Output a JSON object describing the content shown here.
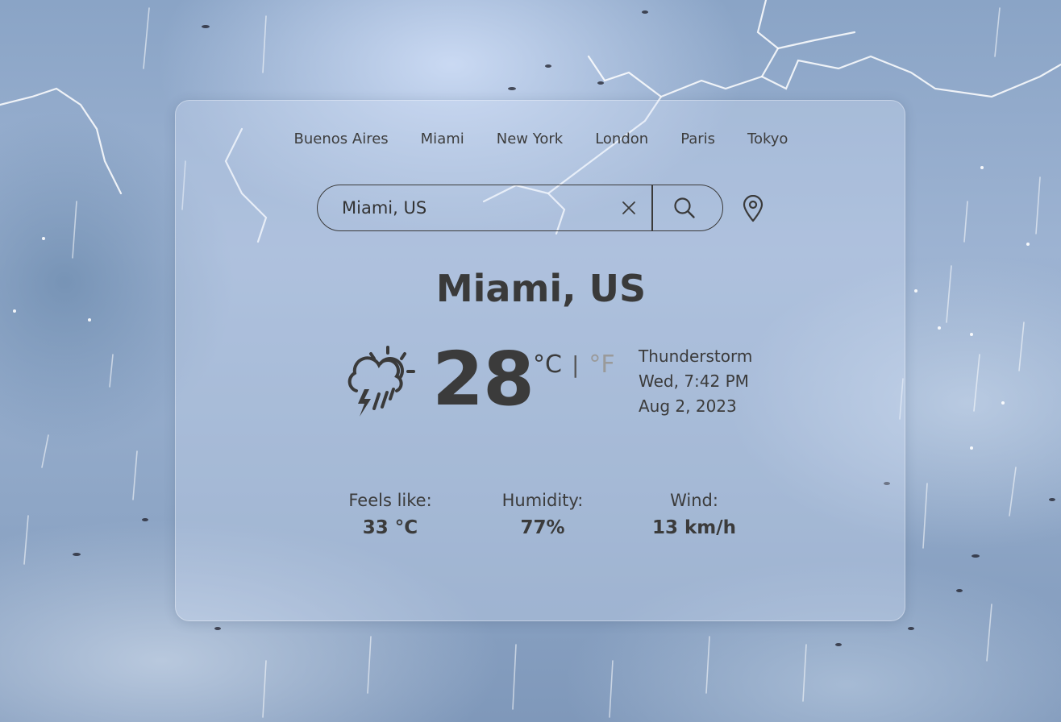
{
  "nav": {
    "cities": [
      "Buenos Aires",
      "Miami",
      "New York",
      "London",
      "Paris",
      "Tokyo"
    ]
  },
  "search": {
    "value": "Miami, US",
    "clear_icon": "close-icon",
    "search_icon": "search-icon",
    "location_icon": "map-pin-icon"
  },
  "current": {
    "city": "Miami, US",
    "icon": "thunderstorm-sun-icon",
    "temperature": "28",
    "unit_celsius": "°C",
    "unit_separator": "|",
    "unit_fahrenheit": "°F",
    "condition": "Thunderstorm",
    "day_time": "Wed, 7:42 PM",
    "date": "Aug 2, 2023"
  },
  "stats": {
    "feels_like_label": "Feels like:",
    "feels_like_value": "33 °C",
    "humidity_label": "Humidity:",
    "humidity_value": "77%",
    "wind_label": "Wind:",
    "wind_value": "13 km/h"
  },
  "colors": {
    "text": "#3b3b3b",
    "inactive_unit": "#9a9a9a"
  }
}
